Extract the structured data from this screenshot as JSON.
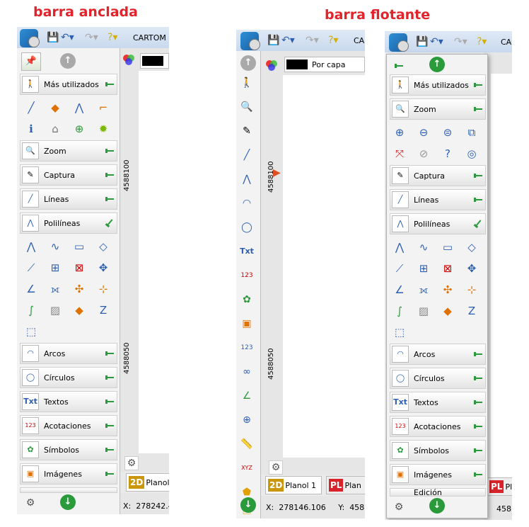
{
  "labels": {
    "docked": "barra anclada",
    "floating": "barra flotante"
  },
  "quick_access": {
    "app_title": "CARTOM",
    "app_title_short": "CA"
  },
  "groups": {
    "most_used": "Más utilizados",
    "zoom": "Zoom",
    "capture": "Captura",
    "lines": "Líneas",
    "polylines": "Polilíneas",
    "arcs": "Arcos",
    "circles": "Círculos",
    "texts": "Textos",
    "dimensions": "Acotaciones",
    "symbols": "Símbolos",
    "images": "Imágenes",
    "edition": "Edición"
  },
  "icon_text": {
    "txt": "Txt",
    "xyz": "XYZ",
    "num": "123",
    "z": "Z"
  },
  "layer": {
    "name": "Por capa"
  },
  "rulers": {
    "upper": "4588100",
    "lower": "4588050"
  },
  "tabs": {
    "badge_2d": "2D",
    "plan_1": "Planol 1",
    "plan_short": "Planol",
    "badge_pl": "PL",
    "plan_cut": "Plan",
    "plan_cut2": "Pla"
  },
  "status": {
    "docked_x_label": "X:",
    "docked_x": "278242.4",
    "floating_x_label": "X:",
    "floating_x": "278146.106",
    "floating_y_label": "Y:",
    "floating_y": "4588",
    "floating2_y": "458"
  },
  "colors": {
    "accent": "#e0242c",
    "pin_green": "#2c9a3c",
    "arrow_green": "#2a9a3a"
  }
}
